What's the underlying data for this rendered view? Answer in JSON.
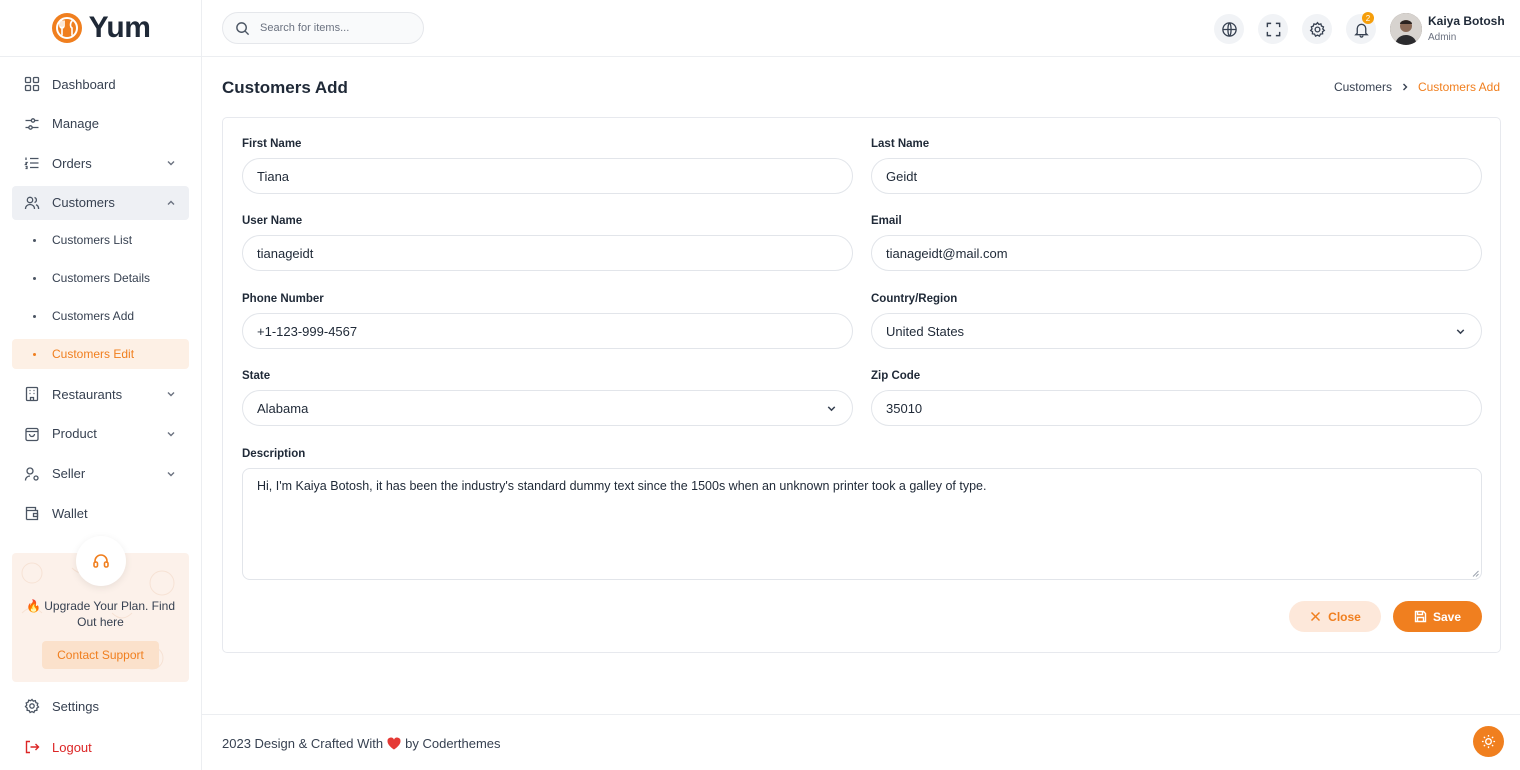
{
  "brand": {
    "name": "Yum",
    "accent": "#f07f1f"
  },
  "sidebar": {
    "items": [
      {
        "label": "Dashboard",
        "icon": "dashboard-grid-icon"
      },
      {
        "label": "Manage",
        "icon": "sliders-icon"
      },
      {
        "label": "Orders",
        "icon": "list-ordered-icon"
      },
      {
        "label": "Customers",
        "icon": "users-icon"
      }
    ],
    "customers_sub": [
      "Customers List",
      "Customers Details",
      "Customers Add",
      "Customers Edit"
    ],
    "items2": [
      {
        "label": "Restaurants",
        "icon": "building-icon"
      },
      {
        "label": "Product",
        "icon": "shopping-bag-icon"
      },
      {
        "label": "Seller",
        "icon": "user-cog-icon"
      },
      {
        "label": "Wallet",
        "icon": "wallet-icon"
      }
    ],
    "promo": {
      "text": "🔥 Upgrade Your Plan. Find Out here",
      "button": "Contact Support"
    },
    "settings": "Settings",
    "logout": "Logout"
  },
  "topbar": {
    "search_placeholder": "Search for items...",
    "notification_count": "2",
    "user_name": "Kaiya Botosh",
    "user_role": "Admin"
  },
  "page": {
    "title": "Customers Add",
    "breadcrumb": [
      "Customers",
      "Customers Add"
    ]
  },
  "form": {
    "first_name": {
      "label": "First Name",
      "value": "Tiana"
    },
    "last_name": {
      "label": "Last Name",
      "value": "Geidt"
    },
    "user_name": {
      "label": "User Name",
      "value": "tianageidt"
    },
    "email": {
      "label": "Email",
      "value": "tianageidt@mail.com"
    },
    "phone": {
      "label": "Phone Number",
      "value": "+1-123-999-4567"
    },
    "country": {
      "label": "Country/Region",
      "value": "United States"
    },
    "state": {
      "label": "State",
      "value": "Alabama"
    },
    "zip": {
      "label": "Zip Code",
      "value": "35010"
    },
    "description": {
      "label": "Description",
      "value": "Hi, I'm Kaiya Botosh, it has been the industry's standard dummy text since the 1500s when an unknown printer took a galley of type."
    },
    "close_label": "Close",
    "save_label": "Save"
  },
  "footer": {
    "prefix": "2023 Design & Crafted With",
    "suffix": "by Coderthemes"
  }
}
